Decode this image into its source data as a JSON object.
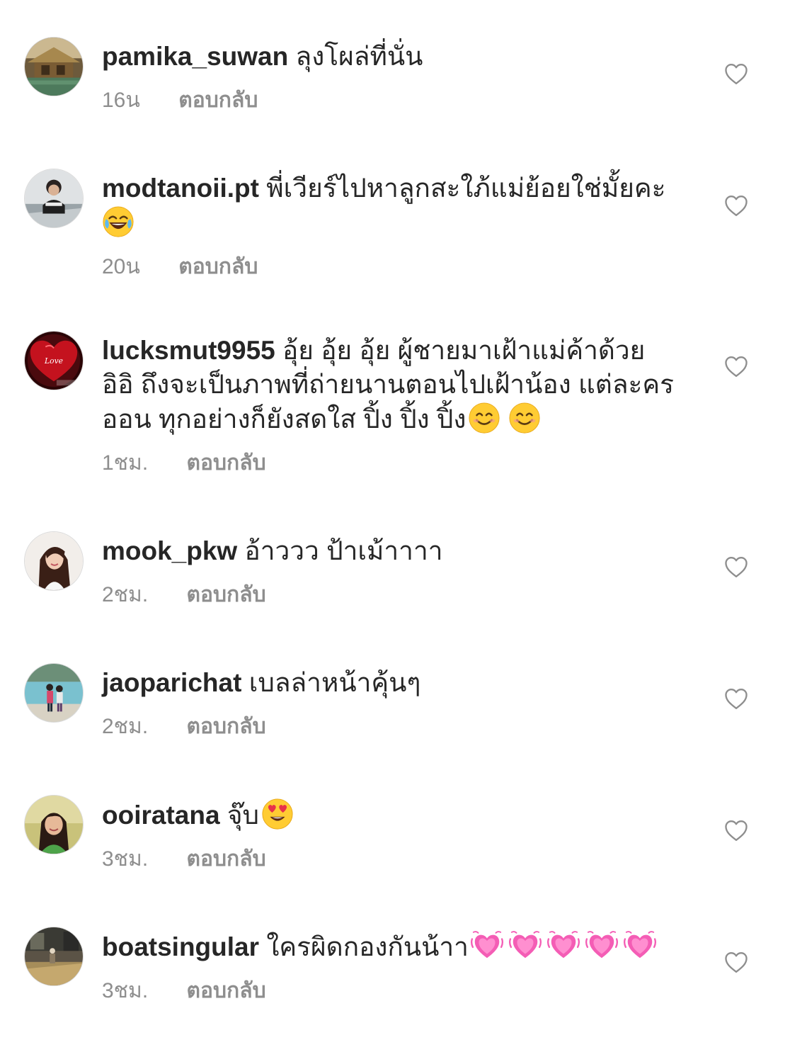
{
  "comments": [
    {
      "username": "pamika_suwan",
      "message": "ลุงโผล่ที่นั่น",
      "time": "16น",
      "reply": "ตอบกลับ",
      "avatar": "avatar-resort-photo"
    },
    {
      "username": "modtanoii.pt",
      "message": "พี่เวียร์ไปหาลูกสะใภ้แม่ย้อยใช่มั้ยคะ",
      "time": "20น",
      "reply": "ตอบกลับ",
      "avatar": "avatar-woman-bathroom",
      "emoji": [
        "joy-emoji"
      ]
    },
    {
      "username": "lucksmut9955",
      "message_line1": "อุ้ย อุ้ย อุ้ย ผู้ชายมาเฝ้าแม่ค้าด้วย",
      "message_line2": "อิอิ ถึงจะเป็นภาพที่ถ่ายนานตอนไปเฝ้าน้อง แต่ละคร",
      "message_line3": "ออน ทุกอย่างก็ยังสดใส ปิ้ง ปิ้ง ปิ้ง",
      "time": "1ชม.",
      "reply": "ตอบกลับ",
      "avatar": "avatar-love-heart",
      "avatar_text": "Love",
      "emoji": [
        "smile-emoji",
        "smile-emoji"
      ]
    },
    {
      "username": "mook_pkw",
      "message": "อ้าววว ป้าเม้าาาา",
      "time": "2ชม.",
      "reply": "ตอบกลับ",
      "avatar": "avatar-woman-portrait"
    },
    {
      "username": "jaoparichat",
      "message": "เบลล่าหน้าคุ้นๆ",
      "time": "2ชม.",
      "reply": "ตอบกลับ",
      "avatar": "avatar-couple-lake"
    },
    {
      "username": "ooiratana",
      "message": "จุ๊บ",
      "time": "3ชม.",
      "reply": "ตอบกลับ",
      "avatar": "avatar-woman-green",
      "emoji": [
        "heart-eyes-emoji"
      ]
    },
    {
      "username": "boatsingular",
      "message": "ใครผิดกองกันน้าา",
      "time": "3ชม.",
      "reply": "ตอบกลับ",
      "avatar": "avatar-street-scene",
      "emoji": [
        "beating-heart-emoji",
        "beating-heart-emoji",
        "beating-heart-emoji",
        "beating-heart-emoji",
        "beating-heart-emoji"
      ]
    }
  ],
  "colors": {
    "text": "#262626",
    "secondary": "#8e8e8e",
    "background": "#ffffff",
    "heart_outline": "#8e8e8e"
  }
}
